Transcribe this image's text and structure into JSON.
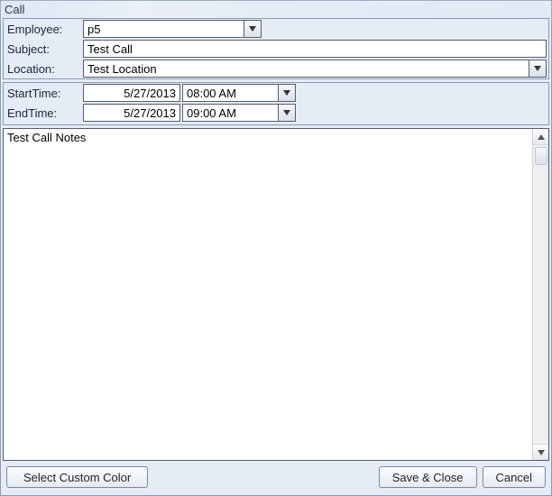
{
  "window": {
    "title": "Call"
  },
  "labels": {
    "employee": "Employee:",
    "subject": "Subject:",
    "location": "Location:",
    "startTime": "StartTime:",
    "endTime": "EndTime:"
  },
  "fields": {
    "employee": "p5",
    "subject": "Test Call",
    "location": "Test Location",
    "startDate": "5/27/2013",
    "startTime": "08:00 AM",
    "endDate": "5/27/2013",
    "endTime": "09:00 AM",
    "notes": "Test Call Notes"
  },
  "buttons": {
    "selectColor": "Select Custom Color",
    "saveClose": "Save & Close",
    "cancel": "Cancel"
  }
}
